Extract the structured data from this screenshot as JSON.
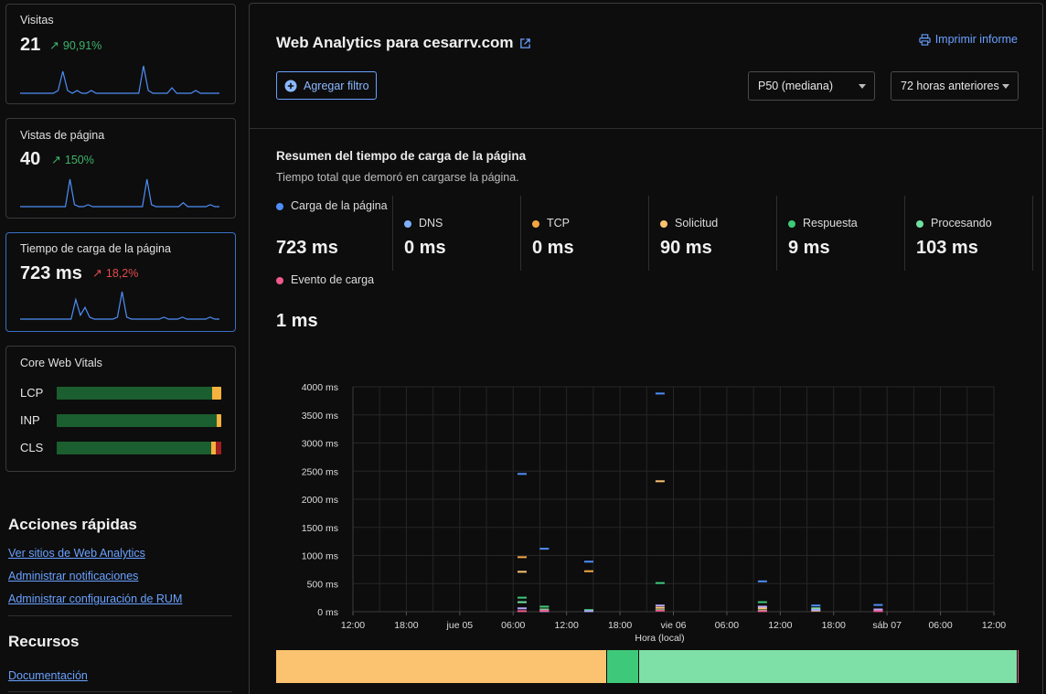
{
  "sidebar": {
    "visits": {
      "label": "Visitas",
      "value": "21",
      "delta": "90,91%",
      "trend": [
        0,
        0,
        0,
        0,
        0,
        0,
        0,
        0,
        1,
        8,
        1,
        0,
        1,
        0,
        0,
        1,
        0,
        0,
        0,
        0,
        0,
        0,
        0,
        0,
        0,
        0,
        10,
        1,
        0,
        0,
        0,
        0,
        2,
        0,
        0,
        0,
        0,
        1,
        0,
        0,
        0,
        0,
        0
      ]
    },
    "pageviews": {
      "label": "Vistas de página",
      "value": "40",
      "delta": "150%",
      "trend": [
        0,
        0,
        0,
        0,
        0,
        0,
        0,
        0,
        0,
        0,
        0,
        14,
        1,
        0,
        0,
        1,
        0,
        0,
        0,
        0,
        0,
        0,
        0,
        0,
        0,
        0,
        0,
        0,
        14,
        1,
        0,
        0,
        0,
        0,
        0,
        0,
        2,
        0,
        0,
        0,
        0,
        0,
        1,
        0,
        0
      ]
    },
    "load": {
      "label": "Tiempo de carga de la página",
      "value": "723 ms",
      "delta": "18,2%",
      "trend": [
        0,
        0,
        0,
        0,
        0,
        0,
        0,
        0,
        0,
        0,
        0,
        0,
        10,
        2,
        6,
        1,
        0,
        0,
        0,
        0,
        0,
        1,
        14,
        1,
        0,
        0,
        0,
        0,
        0,
        0,
        0,
        1,
        0,
        0,
        0,
        1,
        0,
        0,
        0,
        0,
        0,
        1,
        0,
        0
      ]
    },
    "cwv": {
      "title": "Core Web Vitals",
      "rows": [
        {
          "name": "LCP",
          "good": 94.5,
          "ni": 5.5,
          "poor": 0
        },
        {
          "name": "INP",
          "good": 97,
          "ni": 3,
          "poor": 0
        },
        {
          "name": "CLS",
          "good": 94,
          "ni": 2.5,
          "poor": 3.5
        }
      ]
    },
    "quick_actions": {
      "title": "Acciones rápidas",
      "links": [
        "Ver sitios de Web Analytics",
        "Administrar notificaciones",
        "Administrar configuración de RUM"
      ]
    },
    "resources": {
      "title": "Recursos",
      "links": [
        "Documentación"
      ]
    }
  },
  "header": {
    "title": "Web Analytics para cesarrv.com",
    "print": "Imprimir informe",
    "filter": "Agregar filtro",
    "percentile": "P50 (mediana)",
    "range": "72 horas anteriores"
  },
  "summary": {
    "title": "Resumen del tiempo de carga de la página",
    "subtitle": "Tiempo total que demoró en cargarse la página.",
    "metrics": [
      {
        "label": "Carga de la página",
        "value": "723 ms",
        "color": "#4e8ef7"
      },
      {
        "label": "DNS",
        "value": "0 ms",
        "color": "#7fb0ff"
      },
      {
        "label": "TCP",
        "value": "0 ms",
        "color": "#f5a742"
      },
      {
        "label": "Solicitud",
        "value": "90 ms",
        "color": "#fbc36f"
      },
      {
        "label": "Respuesta",
        "value": "9 ms",
        "color": "#3ec97a"
      },
      {
        "label": "Procesando",
        "value": "103 ms",
        "color": "#6fe0a0"
      },
      {
        "label": "Evento de carga",
        "value": "1 ms",
        "color": "#f05a8a"
      }
    ]
  },
  "chart_data": {
    "type": "scatter",
    "xlabel": "Hora (local)",
    "x_ticks": [
      "12:00",
      "18:00",
      "jue 05",
      "06:00",
      "12:00",
      "18:00",
      "vie 06",
      "06:00",
      "12:00",
      "18:00",
      "sáb 07",
      "06:00",
      "12:00"
    ],
    "y_ticks": [
      "0 ms",
      "500 ms",
      "1000 ms",
      "1500 ms",
      "2000 ms",
      "2500 ms",
      "3000 ms",
      "3500 ms",
      "4000 ms"
    ],
    "ylim": [
      0,
      4000
    ],
    "x_hours_range": [
      0,
      72
    ],
    "series": [
      {
        "name": "Carga de la página",
        "color": "#4e8ef7",
        "points": [
          [
            19,
            2450
          ],
          [
            21.5,
            1120
          ],
          [
            26.5,
            890
          ],
          [
            34.5,
            3880
          ],
          [
            46,
            540
          ],
          [
            52,
            110
          ],
          [
            59,
            120
          ]
        ]
      },
      {
        "name": "TCP",
        "color": "#f5a742",
        "points": [
          [
            19,
            970
          ],
          [
            26.5,
            720
          ]
        ]
      },
      {
        "name": "Solicitud",
        "color": "#fbc36f",
        "points": [
          [
            19,
            710
          ],
          [
            34.5,
            2320
          ],
          [
            34.5,
            70
          ],
          [
            46,
            60
          ],
          [
            52,
            20
          ],
          [
            59,
            20
          ]
        ]
      },
      {
        "name": "Respuesta",
        "color": "#3ec97a",
        "points": [
          [
            19,
            250
          ],
          [
            21.5,
            90
          ],
          [
            26.5,
            30
          ],
          [
            34.5,
            510
          ],
          [
            46,
            170
          ]
        ]
      },
      {
        "name": "Procesando",
        "color": "#6fe0a0",
        "points": [
          [
            19,
            170
          ],
          [
            21.5,
            40
          ],
          [
            34.5,
            30
          ],
          [
            46,
            20
          ],
          [
            52,
            60
          ]
        ]
      },
      {
        "name": "DNS",
        "color": "#b8a7ff",
        "points": [
          [
            19,
            60
          ],
          [
            21.5,
            10
          ],
          [
            26.5,
            10
          ],
          [
            34.5,
            110
          ],
          [
            46,
            90
          ],
          [
            52,
            30
          ],
          [
            59,
            40
          ]
        ]
      },
      {
        "name": "Evento de carga",
        "color": "#f05a8a",
        "points": [
          [
            19,
            10
          ],
          [
            21.5,
            20
          ],
          [
            34.5,
            20
          ],
          [
            46,
            10
          ],
          [
            59,
            10
          ]
        ]
      }
    ],
    "stack": [
      {
        "color": "#fbc36f",
        "fraction": 0.445
      },
      {
        "color": "#3ec97a",
        "fraction": 0.043
      },
      {
        "color": "#7ee0a6",
        "fraction": 0.51
      },
      {
        "color": "#f05a8a",
        "fraction": 0.002
      }
    ]
  }
}
